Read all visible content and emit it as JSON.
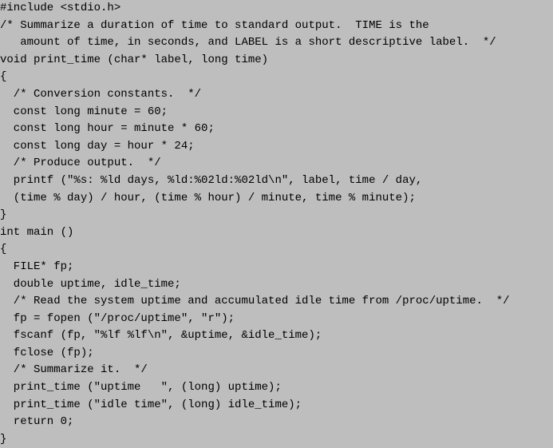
{
  "lines": [
    "#include <stdio.h>",
    "/* Summarize a duration of time to standard output.  TIME is the",
    "   amount of time, in seconds, and LABEL is a short descriptive label.  */",
    "void print_time (char* label, long time)",
    "{",
    "  /* Conversion constants.  */",
    "  const long minute = 60;",
    "  const long hour = minute * 60;",
    "  const long day = hour * 24;",
    "  /* Produce output.  */",
    "  printf (\"%s: %ld days, %ld:%02ld:%02ld\\n\", label, time / day,",
    "  (time % day) / hour, (time % hour) / minute, time % minute);",
    "}",
    "int main ()",
    "{",
    "  FILE* fp;",
    "  double uptime, idle_time;",
    "  /* Read the system uptime and accumulated idle time from /proc/uptime.  */",
    "  fp = fopen (\"/proc/uptime\", \"r\");",
    "  fscanf (fp, \"%lf %lf\\n\", &uptime, &idle_time);",
    "  fclose (fp);",
    "  /* Summarize it.  */",
    "  print_time (\"uptime   \", (long) uptime);",
    "  print_time (\"idle time\", (long) idle_time);",
    "  return 0;",
    "}"
  ]
}
